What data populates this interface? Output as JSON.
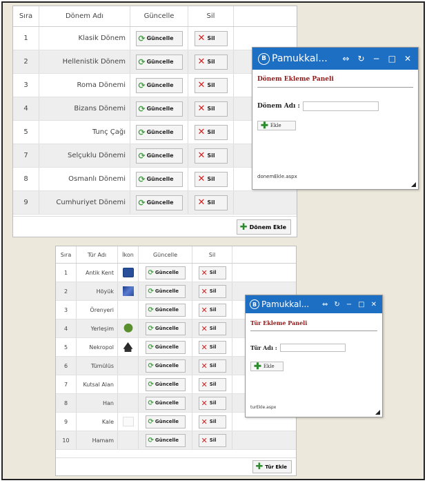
{
  "table1": {
    "headers": {
      "sira": "Sıra",
      "name": "Dönem Adı",
      "update": "Güncelle",
      "delete": "Sil"
    },
    "rows": [
      {
        "no": "1",
        "name": "Klasik Dönem"
      },
      {
        "no": "2",
        "name": "Hellenistik Dönem"
      },
      {
        "no": "3",
        "name": "Roma Dönemi"
      },
      {
        "no": "4",
        "name": "Bizans Dönemi"
      },
      {
        "no": "5",
        "name": "Tunç Çağı"
      },
      {
        "no": "7",
        "name": "Selçuklu Dönemi"
      },
      {
        "no": "8",
        "name": "Osmanlı Dönemi"
      },
      {
        "no": "9",
        "name": "Cumhuriyet Dönemi"
      }
    ],
    "update_label": "Güncelle",
    "delete_label": "Sil",
    "add_label": "Dönem Ekle"
  },
  "table2": {
    "headers": {
      "sira": "Sıra",
      "name": "Tür Adı",
      "icon": "İkon",
      "update": "Güncelle",
      "delete": "Sil"
    },
    "rows": [
      {
        "no": "1",
        "name": "Antik Kent",
        "icon": "blue-square-icon"
      },
      {
        "no": "2",
        "name": "Höyük",
        "icon": "photo-thumbnail-icon"
      },
      {
        "no": "3",
        "name": "Örenyeri",
        "icon": ""
      },
      {
        "no": "4",
        "name": "Yerleşim",
        "icon": "tree-icon"
      },
      {
        "no": "5",
        "name": "Nekropol",
        "icon": "hut-icon"
      },
      {
        "no": "6",
        "name": "Tümülüs",
        "icon": ""
      },
      {
        "no": "7",
        "name": "Kutsal Alan",
        "icon": ""
      },
      {
        "no": "8",
        "name": "Han",
        "icon": ""
      },
      {
        "no": "9",
        "name": "Kale",
        "icon": "blank-image-icon"
      },
      {
        "no": "10",
        "name": "Hamam",
        "icon": ""
      }
    ],
    "update_label": "Güncelle",
    "delete_label": "Sil",
    "add_label": "Tür Ekle"
  },
  "window1": {
    "title": "Pamukkal...",
    "logo": "B",
    "panel_title": "Dönem Ekleme Paneli",
    "field_label": "Dönem Adı :",
    "field_value": "",
    "button_label": "Ekle",
    "status": "donemEkle.aspx"
  },
  "window2": {
    "title": "Pamukkal...",
    "logo": "B",
    "panel_title": "Tür Ekleme Paneli",
    "field_label": "Tür Adı :",
    "field_value": "",
    "button_label": "Ekle",
    "status": "turEkle.aspx"
  },
  "colors": {
    "titlebar": "#1d6fc4",
    "panel_title": "#8b1a1a",
    "background": "#ede8dc"
  }
}
